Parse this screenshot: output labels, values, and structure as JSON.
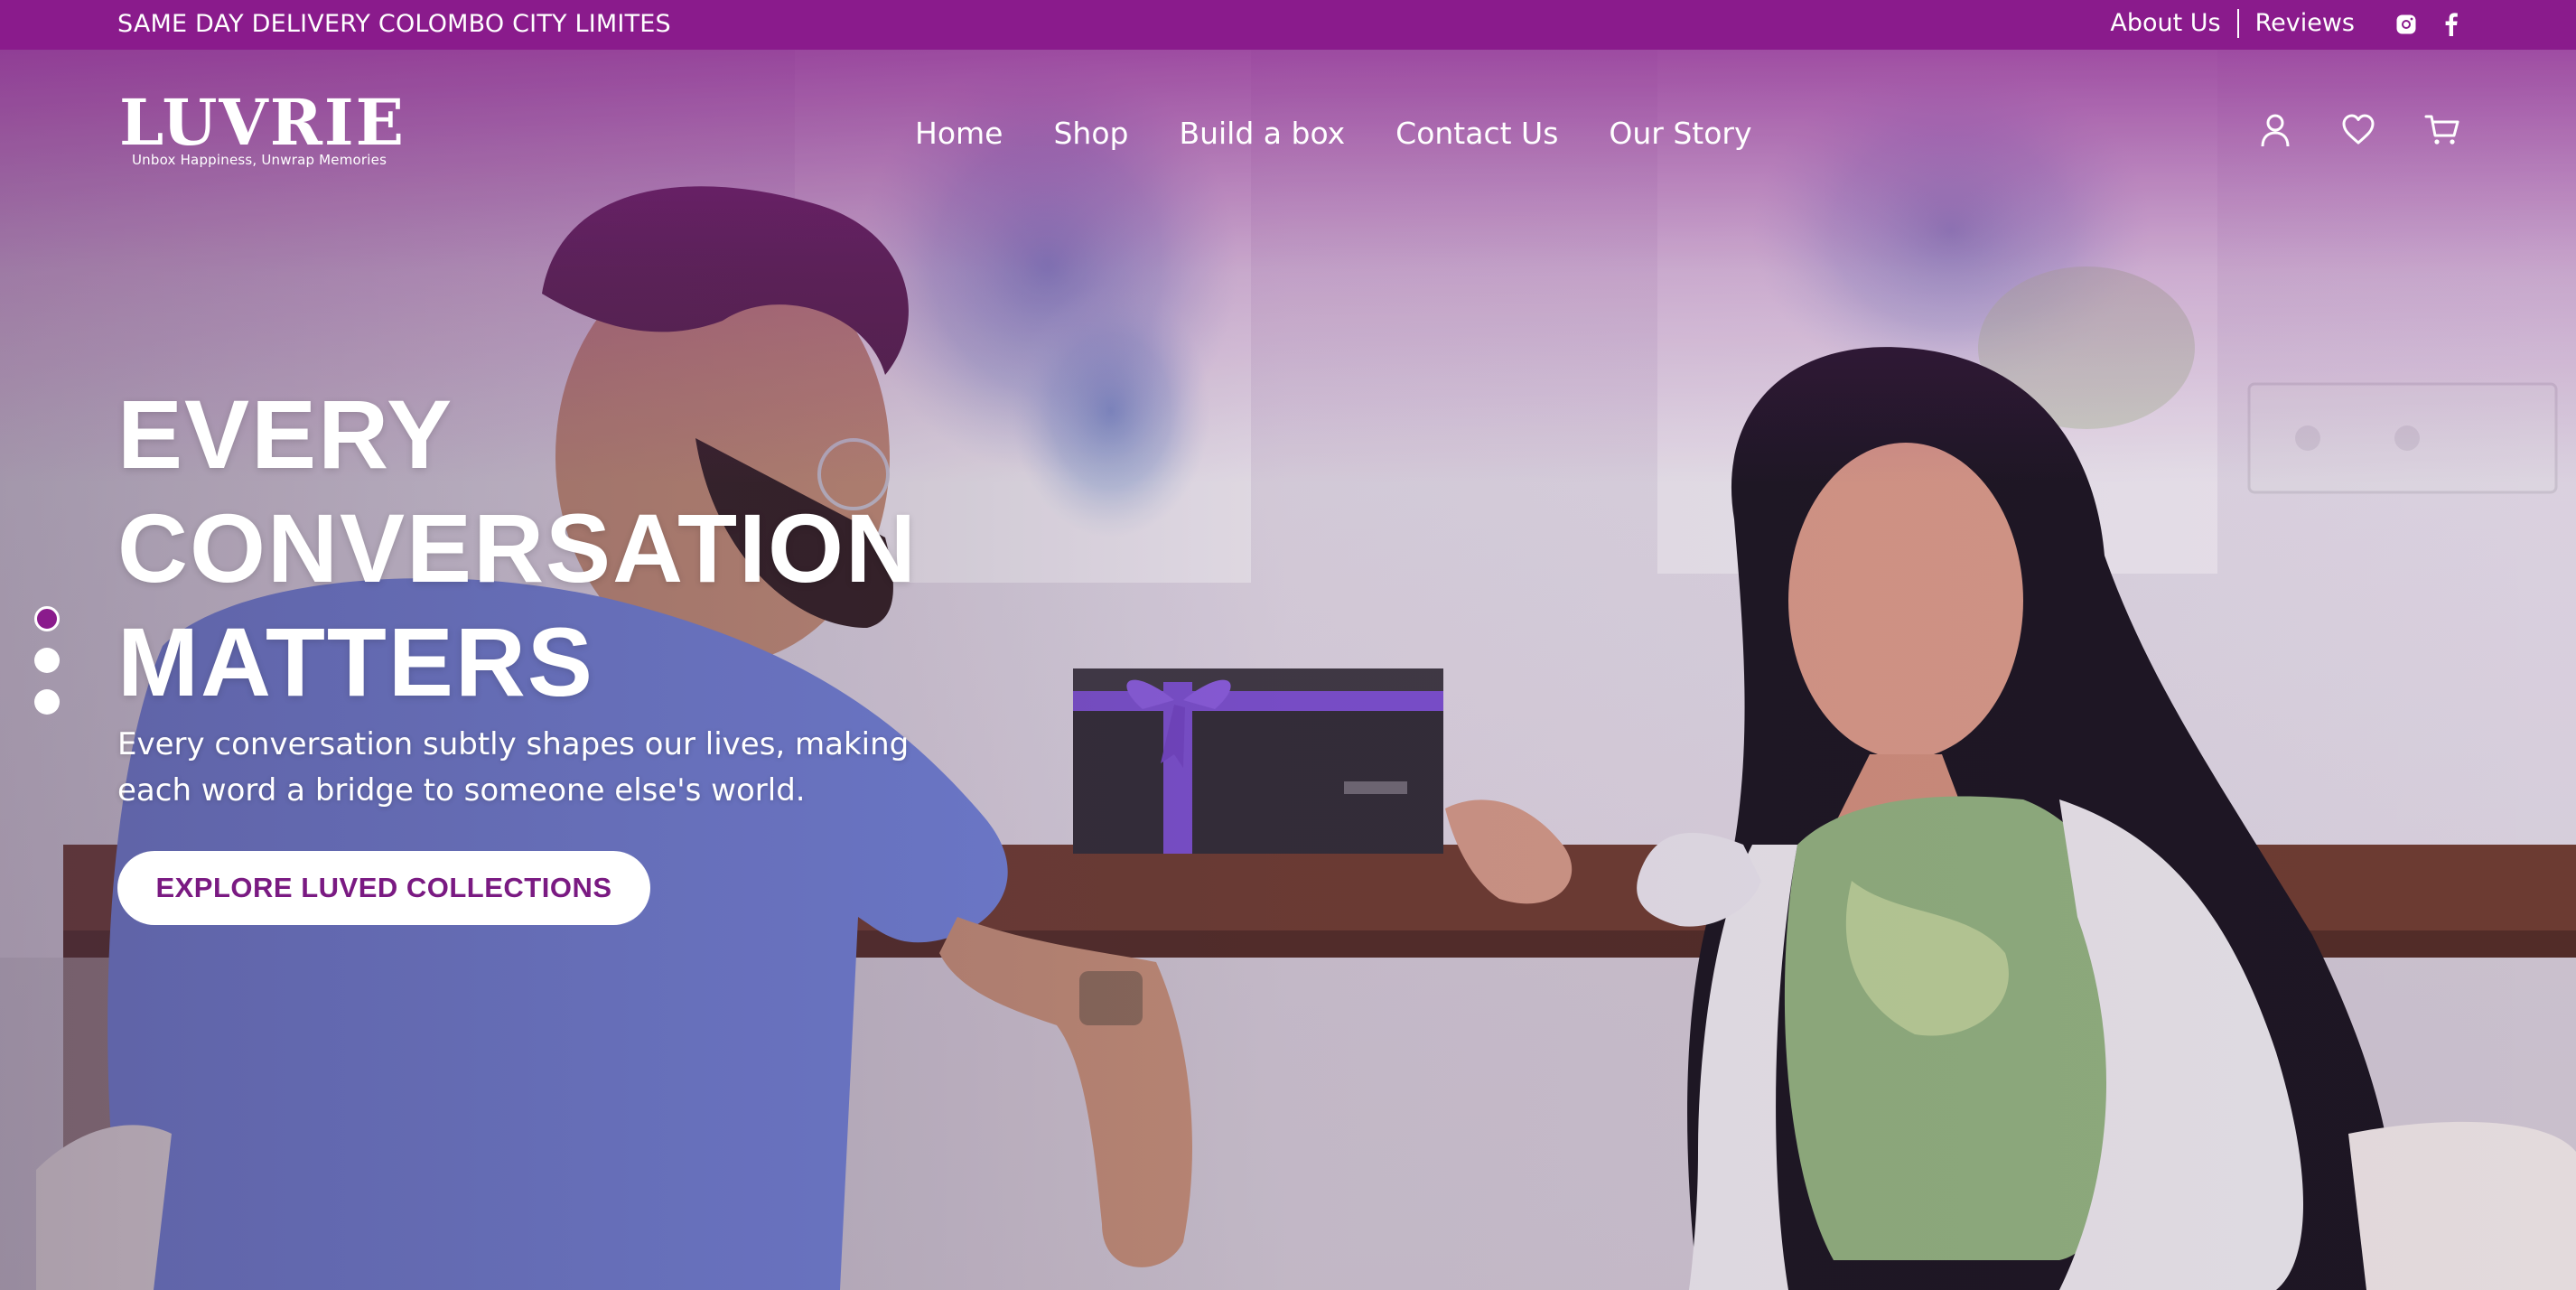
{
  "topbar": {
    "announcement": "SAME DAY DELIVERY COLOMBO CITY LIMITES",
    "about_label": "About Us",
    "reviews_label": "Reviews",
    "social": [
      "instagram-icon",
      "facebook-icon"
    ]
  },
  "brand": {
    "name": "LUVRIE",
    "tagline": "Unbox Happiness, Unwrap Memories"
  },
  "nav": {
    "items": [
      "Home",
      "Shop",
      "Build a box",
      "Contact Us",
      "Our Story"
    ]
  },
  "header_icons": [
    "user-icon",
    "heart-icon",
    "cart-icon"
  ],
  "hero": {
    "headline_lines": [
      "EVERY",
      "CONVERSATION",
      "MATTERS"
    ],
    "subtext": "Every conversation subtly shapes our lives, making each word a bridge to someone else's world.",
    "cta_label": "EXPLORE LUVED COLLECTIONS",
    "slides": 3,
    "active_slide": 1
  },
  "colors": {
    "brand_purple": "#8a1b8c",
    "cta_text": "#7a1a82",
    "white": "#ffffff"
  }
}
